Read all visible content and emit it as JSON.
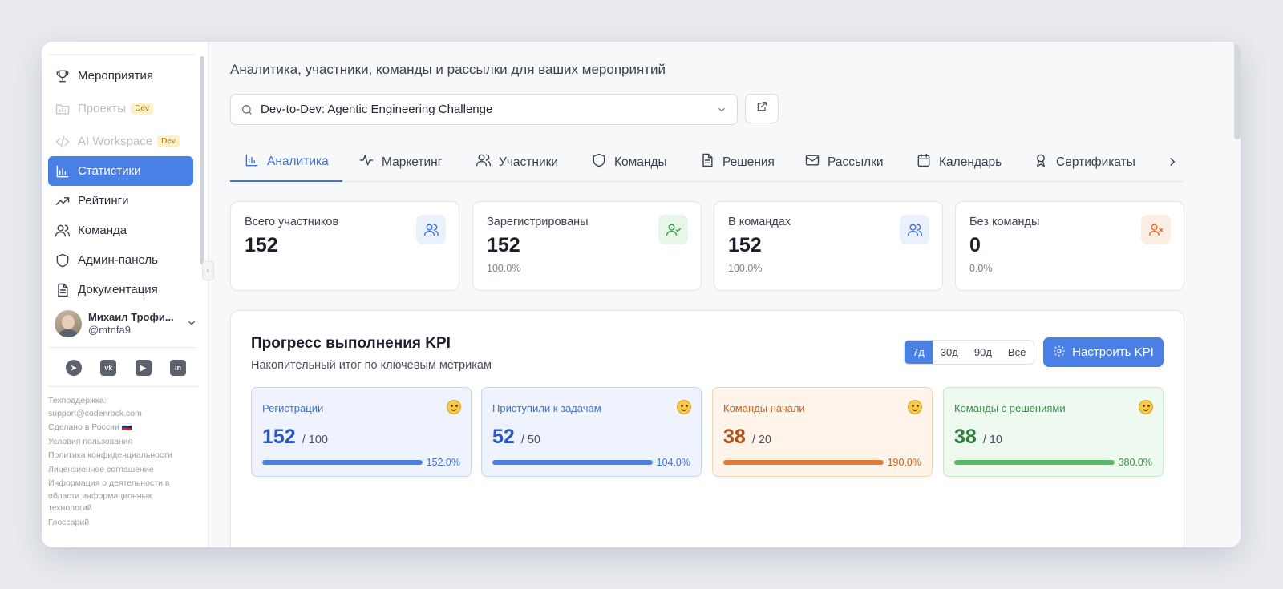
{
  "sidebar": {
    "items": [
      {
        "label": "Мероприятия",
        "icon": "trophy-icon",
        "state": "normal"
      },
      {
        "label": "Проекты",
        "icon": "folder-chart-icon",
        "state": "disabled",
        "badge": "Dev"
      },
      {
        "label": "AI Workspace",
        "icon": "code-icon",
        "state": "disabled",
        "badge": "Dev"
      },
      {
        "label": "Статистики",
        "icon": "bar-chart-icon",
        "state": "active"
      },
      {
        "label": "Рейтинги",
        "icon": "trending-up-icon",
        "state": "normal"
      },
      {
        "label": "Команда",
        "icon": "users-icon",
        "state": "normal"
      },
      {
        "label": "Админ-панель",
        "icon": "shield-icon",
        "state": "normal"
      },
      {
        "label": "Документация",
        "icon": "document-icon",
        "state": "normal"
      }
    ],
    "user": {
      "name": "Михаил Трофи...",
      "handle": "@mtnfa9"
    },
    "socials": [
      "telegram-icon",
      "vk-icon",
      "youtube-icon",
      "linkedin-icon"
    ],
    "footer": [
      "Техподдержка: support@codenrock.com",
      "Сделано в России 🇷🇺",
      "Условия пользования",
      "Политика конфиденциальности",
      "Лицензионное соглашение",
      "Информация о деятельности в области информационных технологий",
      "Глоссарий"
    ]
  },
  "header": {
    "subtitle": "Аналитика, участники, команды и рассылки для ваших мероприятий",
    "event_select": "Dev-to-Dev: Agentic Engineering Challenge"
  },
  "tabs": [
    {
      "label": "Аналитика",
      "icon": "bar-chart-icon",
      "active": true
    },
    {
      "label": "Маркетинг",
      "icon": "activity-icon"
    },
    {
      "label": "Участники",
      "icon": "users-icon"
    },
    {
      "label": "Команды",
      "icon": "shield-icon"
    },
    {
      "label": "Решения",
      "icon": "document-icon"
    },
    {
      "label": "Рассылки",
      "icon": "mail-icon"
    },
    {
      "label": "Календарь",
      "icon": "calendar-icon"
    },
    {
      "label": "Сертификаты",
      "icon": "award-icon"
    }
  ],
  "stats": [
    {
      "label": "Всего участников",
      "value": "152",
      "pct": "",
      "icon": "users-icon",
      "color": "#3f72d9",
      "bg": "#eaf0fc"
    },
    {
      "label": "Зарегистрированы",
      "value": "152",
      "pct": "100.0%",
      "icon": "user-check-icon",
      "color": "#3f9a4c",
      "bg": "#e8f6ea"
    },
    {
      "label": "В командах",
      "value": "152",
      "pct": "100.0%",
      "icon": "users-icon",
      "color": "#3f72d9",
      "bg": "#eaf0fc"
    },
    {
      "label": "Без команды",
      "value": "0",
      "pct": "0.0%",
      "icon": "user-x-icon",
      "color": "#e06a2c",
      "bg": "#fdeee4"
    }
  ],
  "kpi": {
    "title": "Прогресс выполнения KPI",
    "subtitle": "Накопительный итог по ключевым метрикам",
    "ranges": [
      "7д",
      "30д",
      "90д",
      "Всё"
    ],
    "selected_range": "7д",
    "configure_label": "Настроить KPI",
    "cards": [
      {
        "name": "Регистрации",
        "current": "152",
        "target": "/ 100",
        "pct": "152.0%",
        "progress": 1.0,
        "color": "#3f72d9",
        "value_color": "#2a57c4",
        "bg": "#eef3fd",
        "border": "#c7d7f7",
        "bar": "#4a7fe6"
      },
      {
        "name": "Приступили к задачам",
        "current": "52",
        "target": "/ 50",
        "pct": "104.0%",
        "progress": 1.0,
        "color": "#3f72d9",
        "value_color": "#2a57c4",
        "bg": "#eef3fd",
        "border": "#c7d7f7",
        "bar": "#4a7fe6"
      },
      {
        "name": "Команды начали",
        "current": "38",
        "target": "/ 20",
        "pct": "190.0%",
        "progress": 1.0,
        "color": "#c9611f",
        "value_color": "#b24f14",
        "bg": "#fff4ea",
        "border": "#f6d3b2",
        "bar": "#e57a33"
      },
      {
        "name": "Команды с решениями",
        "current": "38",
        "target": "/ 10",
        "pct": "380.0%",
        "progress": 1.0,
        "color": "#3a8e48",
        "value_color": "#2f7e3d",
        "bg": "#eef9f0",
        "border": "#c3e8ca",
        "bar": "#57bb63"
      }
    ]
  }
}
